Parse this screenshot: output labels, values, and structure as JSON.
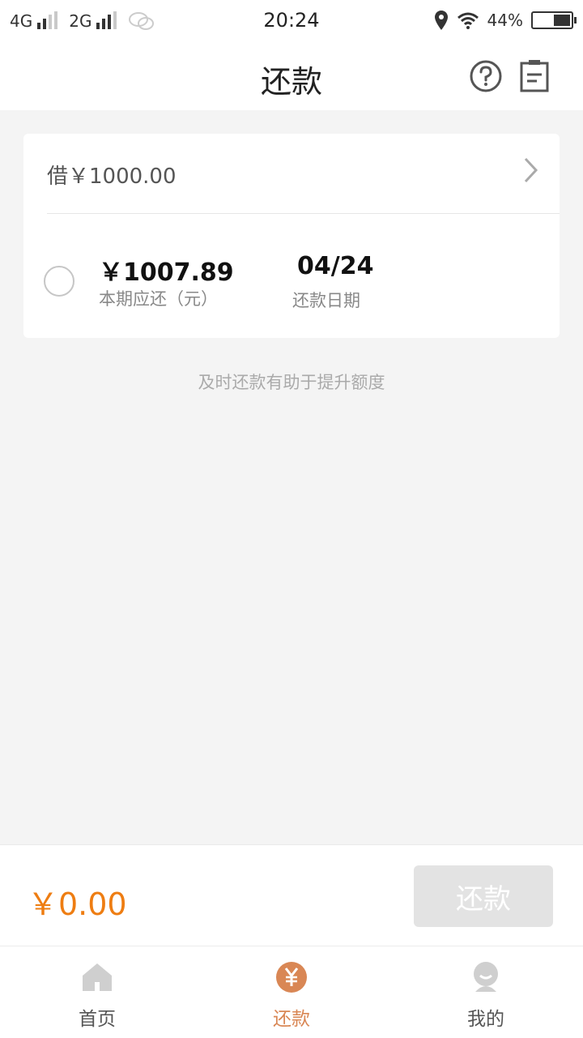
{
  "status_bar": {
    "network1": "4G",
    "network2": "2G",
    "time": "20:24",
    "battery": "44%"
  },
  "header": {
    "title": "还款"
  },
  "loan": {
    "label": "借￥1000.00",
    "amount_due": "￥1007.89",
    "amount_due_label": "本期应还（元）",
    "due_date": "04/24",
    "due_date_label": "还款日期"
  },
  "tip": "及时还款有助于提升额度",
  "paybar": {
    "total": "￥0.00",
    "button_label": "还款"
  },
  "tabs": [
    {
      "label": "首页",
      "icon": "home-icon"
    },
    {
      "label": "还款",
      "icon": "yen-icon"
    },
    {
      "label": "我的",
      "icon": "profile-icon"
    }
  ],
  "colors": {
    "accent_orange": "#ee7d12",
    "active_tab": "#d98755",
    "disabled_button": "#e3e3e3"
  }
}
